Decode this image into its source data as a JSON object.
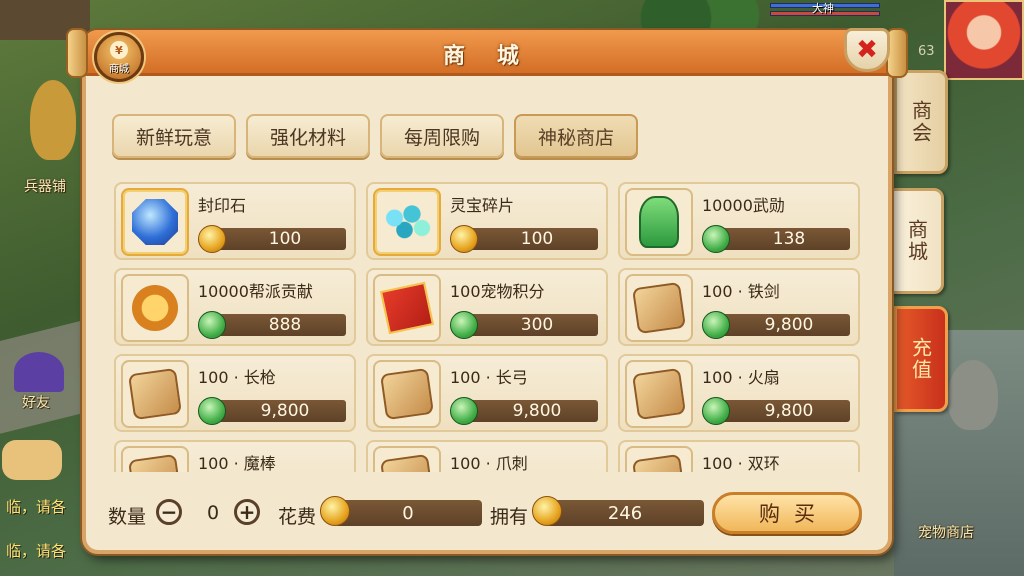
{
  "background": {
    "labels": [
      "兵器铺",
      "好友",
      "宠物商店"
    ],
    "chat_lines": [
      "临，请各",
      "临，请各"
    ],
    "hud": {
      "name_left": "大神",
      "name_right": "大神",
      "level": "63"
    }
  },
  "panel": {
    "title": "商 城",
    "badge_label": "商城",
    "badge_coin": "¥",
    "close_symbol": "✖"
  },
  "side_tabs": [
    {
      "label": "商会"
    },
    {
      "label": "商城"
    },
    {
      "label": "充值"
    }
  ],
  "category_tabs": [
    {
      "label": "新鲜玩意"
    },
    {
      "label": "强化材料"
    },
    {
      "label": "每周限购"
    },
    {
      "label": "神秘商店"
    }
  ],
  "items": [
    {
      "name": "封印石",
      "price": "100",
      "currency": "gold-coin-icon",
      "icon": "seal-stone-icon"
    },
    {
      "name": "灵宝碎片",
      "price": "100",
      "currency": "gold-coin-icon",
      "icon": "spirit-shard-icon"
    },
    {
      "name": "10000武勋",
      "price": "138",
      "currency": "jade-icon",
      "icon": "merit-token-icon"
    },
    {
      "name": "10000帮派贡献",
      "price": "888",
      "currency": "jade-icon",
      "icon": "guild-medal-icon"
    },
    {
      "name": "100宠物积分",
      "price": "300",
      "currency": "jade-icon",
      "icon": "pet-ticket-icon"
    },
    {
      "name": "100 · 铁剑",
      "price": "9,800",
      "currency": "jade-icon",
      "icon": "sword-scroll-icon"
    },
    {
      "name": "100 · 长枪",
      "price": "9,800",
      "currency": "jade-icon",
      "icon": "spear-scroll-icon"
    },
    {
      "name": "100 · 长弓",
      "price": "9,800",
      "currency": "jade-icon",
      "icon": "bow-scroll-icon"
    },
    {
      "name": "100 · 火扇",
      "price": "9,800",
      "currency": "jade-icon",
      "icon": "fan-scroll-icon"
    },
    {
      "name": "100 · 魔棒",
      "price": "",
      "currency": "jade-icon",
      "icon": "wand-scroll-icon"
    },
    {
      "name": "100 · 爪刺",
      "price": "",
      "currency": "jade-icon",
      "icon": "claw-scroll-icon"
    },
    {
      "name": "100 · 双环",
      "price": "",
      "currency": "jade-icon",
      "icon": "rings-scroll-icon"
    }
  ],
  "purchase": {
    "quantity_label": "数量",
    "quantity": "0",
    "minus": "−",
    "plus": "+",
    "cost_label": "花费",
    "cost": "0",
    "owned_label": "拥有",
    "owned": "246",
    "buy_label": "购买"
  }
}
